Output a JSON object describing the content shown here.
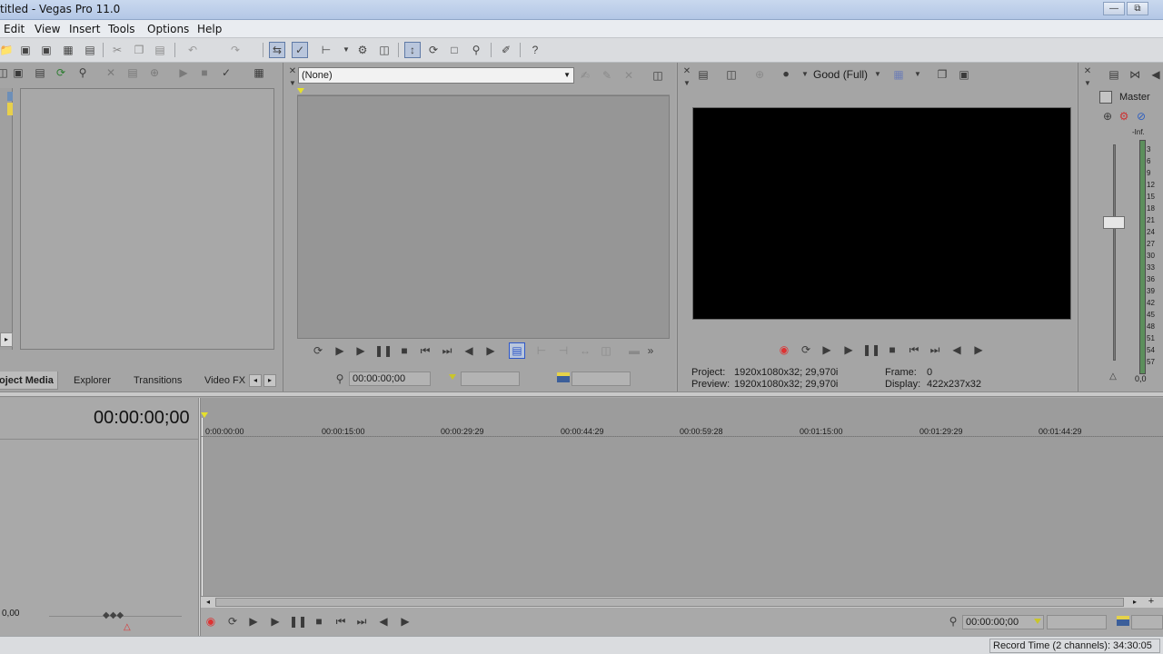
{
  "window": {
    "title": "titled - Vegas Pro 11.0",
    "minimize_glyph": "—",
    "restore_glyph": "⧉"
  },
  "menu": [
    "Edit",
    "View",
    "Insert",
    "Tools",
    "Options",
    "Help"
  ],
  "project_media": {
    "tabs": [
      "oject Media",
      "Explorer",
      "Transitions",
      "Video FX"
    ],
    "tab_prev_glyph": "◂",
    "tab_next_glyph": "▸",
    "expand_glyph": "▸"
  },
  "trimmer": {
    "source_value": "(None)",
    "timecode": "00:00:00;00",
    "more_glyph": "»"
  },
  "preview": {
    "quality": "Good (Full)",
    "project_label": "Project:",
    "project_value": "1920x1080x32; 29,970i",
    "preview_label": "Preview:",
    "preview_value": "1920x1080x32; 29,970i",
    "frame_label": "Frame:",
    "frame_value": "0",
    "display_label": "Display:",
    "display_value": "422x237x32"
  },
  "mixer": {
    "title": "Master",
    "inf_label": "-Inf.",
    "scale": [
      "3",
      "6",
      "9",
      "12",
      "15",
      "18",
      "21",
      "24",
      "27",
      "30",
      "33",
      "36",
      "39",
      "42",
      "45",
      "48",
      "51",
      "54",
      "57"
    ],
    "readout": "0,0"
  },
  "timeline": {
    "timecode": "00:00:00;00",
    "ruler": [
      "0:00:00:00",
      "00:00:15:00",
      "00:00:29:29",
      "00:00:44:29",
      "00:00:59:28",
      "00:01:15:00",
      "00:01:29:29",
      "00:01:44:29"
    ],
    "rate_value": "0,00",
    "transport_timecode": "00:00:00;00",
    "scroll_left_glyph": "◂",
    "scroll_right_glyph": "▸",
    "zoom_in_glyph": "+"
  },
  "status": {
    "record_time": "Record Time (2 channels): 34:30:05"
  }
}
